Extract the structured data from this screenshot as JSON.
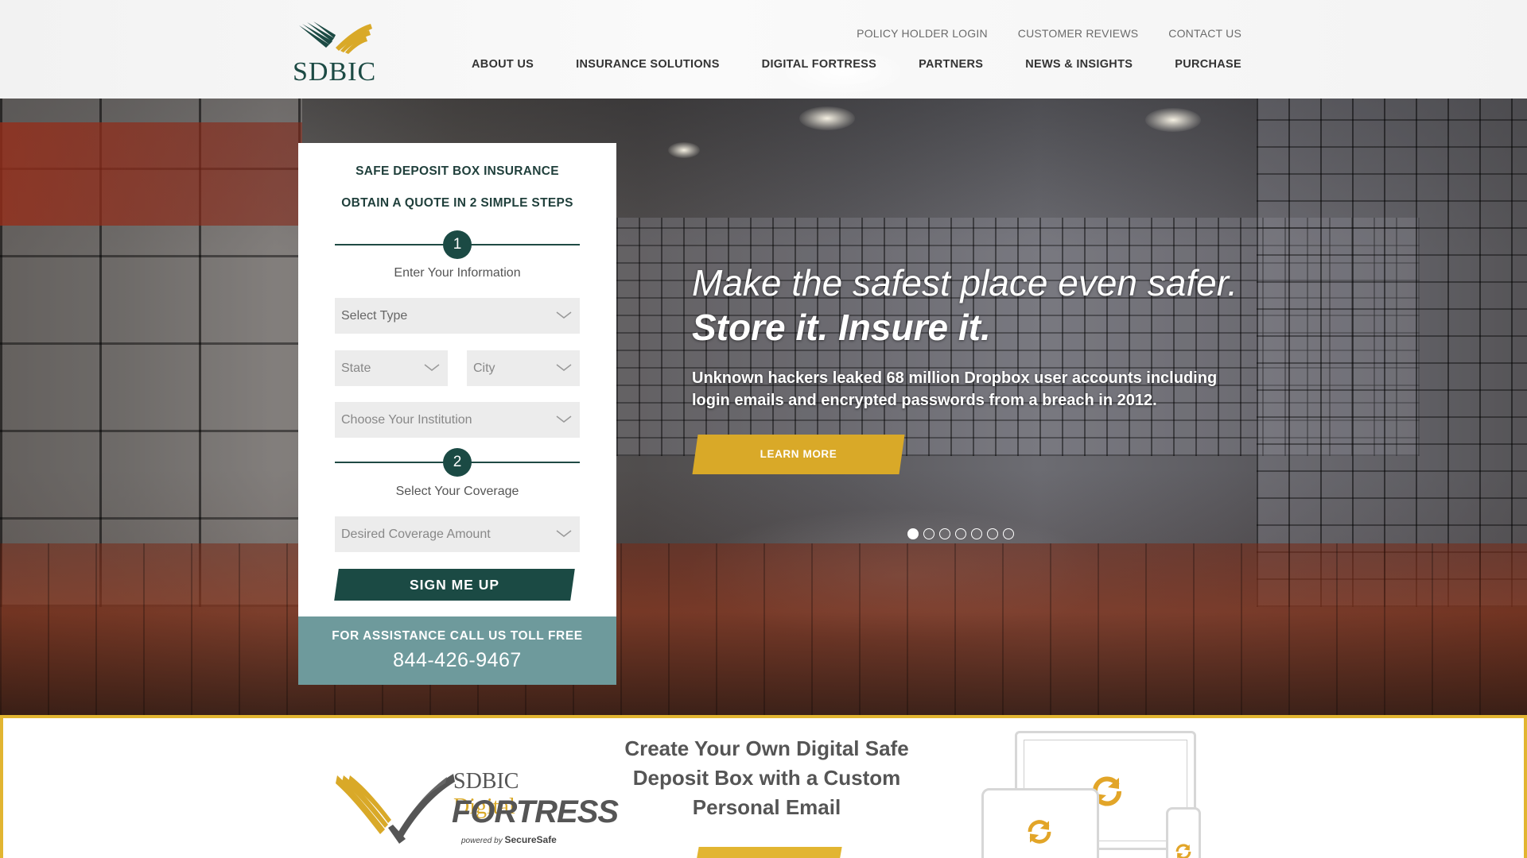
{
  "brand": {
    "name": "SDBIC",
    "colors": {
      "primary": "#1b4a44",
      "accent": "#d9a928",
      "assist": "#6e9a9c"
    }
  },
  "header": {
    "top_links": [
      "POLICY HOLDER LOGIN",
      "CUSTOMER REVIEWS",
      "CONTACT US"
    ],
    "nav": [
      "ABOUT US",
      "INSURANCE SOLUTIONS",
      "DIGITAL FORTRESS",
      "PARTNERS",
      "NEWS & INSIGHTS",
      "PURCHASE"
    ]
  },
  "quote_form": {
    "title": "SAFE DEPOSIT BOX INSURANCE",
    "subtitle": "OBTAIN A QUOTE IN 2 SIMPLE STEPS",
    "step1": {
      "number": "1",
      "label": "Enter Your Information"
    },
    "step2": {
      "number": "2",
      "label": "Select Your Coverage"
    },
    "fields": {
      "type": "Select Type",
      "state": "State",
      "city": "City",
      "institution": "Choose Your Institution",
      "coverage": "Desired Coverage Amount"
    },
    "submit_label": "SIGN ME UP",
    "assistance_title": "FOR ASSISTANCE CALL US TOLL FREE",
    "assistance_phone": "844-426-9467"
  },
  "hero": {
    "tagline_line1": "Make the safest place even safer.",
    "tagline_line2": "Store it. Insure it.",
    "body": "Unknown hackers leaked 68 million Dropbox user accounts including login emails and encrypted passwords from a breach in 2012.",
    "cta_label": "LEARN MORE",
    "slide_count": 7,
    "active_slide": 1
  },
  "fortress_banner": {
    "logo_sdbic": "SDBIC",
    "logo_digital": "Digital",
    "logo_fortress": "FORTRESS",
    "logo_powered": "powered by",
    "logo_securesafe": "SecureSafe",
    "heading": "Create Your Own Digital Safe Deposit Box with a Custom Personal Email",
    "icons": [
      "monitor-icon",
      "tablet-icon",
      "phone-icon",
      "sync-icon"
    ]
  }
}
